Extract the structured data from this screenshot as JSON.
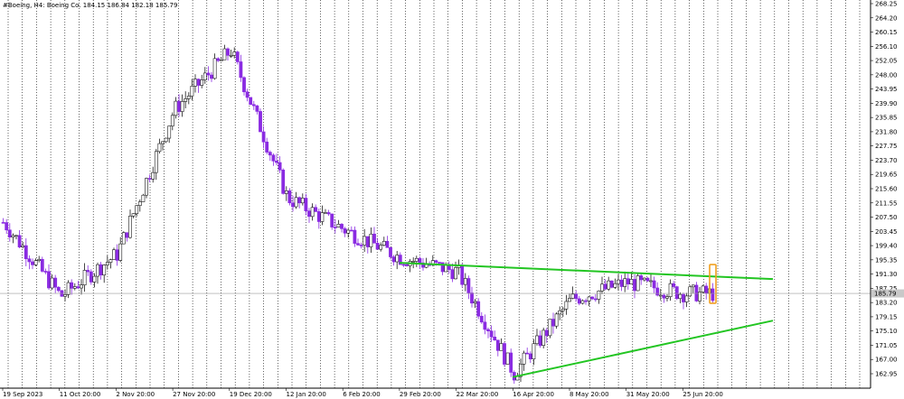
{
  "chart_data": {
    "type": "candlestick",
    "symbol_info": "#Boeing, H4:  Boeing Co.  184.15 186.84 182.18 185.79",
    "current_price": 185.79,
    "current_price_label": "185.79",
    "ylim": [
      160.0,
      268.25
    ],
    "x_ticks": [
      "19 Sep 2023",
      "11 Oct 20:00",
      "2 Nov 20:00",
      "27 Nov 20:00",
      "19 Dec 20:00",
      "12 Jan 20:00",
      "6 Feb 20:00",
      "29 Feb 20:00",
      "22 Mar 20:00",
      "16 Apr 20:00",
      "8 May 20:00",
      "31 May 20:00",
      "25 Jun 20:00"
    ],
    "y_ticks": [
      "268.25",
      "264.20",
      "260.15",
      "256.10",
      "252.05",
      "248.00",
      "243.95",
      "239.90",
      "235.85",
      "231.80",
      "227.75",
      "223.70",
      "219.65",
      "215.60",
      "211.55",
      "207.50",
      "203.45",
      "199.40",
      "195.35",
      "191.30",
      "187.25",
      "183.20",
      "179.15",
      "175.10",
      "171.05",
      "167.00",
      "162.95"
    ],
    "series": [
      {
        "name": "close",
        "x": [
          "19 Sep 2023",
          "11 Oct 20:00",
          "2 Nov 20:00",
          "27 Nov 20:00",
          "19 Dec 20:00",
          "12 Jan 20:00",
          "6 Feb 20:00",
          "29 Feb 20:00",
          "22 Mar 20:00",
          "16 Apr 20:00",
          "8 May 20:00",
          "31 May 20:00",
          "25 Jun 20:00"
        ],
        "values": [
          206.0,
          185.0,
          197.0,
          238.0,
          255.0,
          213.0,
          204.0,
          196.0,
          192.0,
          163.0,
          184.0,
          189.0,
          185.79
        ]
      }
    ],
    "trendlines": [
      {
        "name": "resistance",
        "color": "#22c522",
        "points": [
          [
            "29 Feb 20:00",
            194.5
          ],
          [
            "25 Jun 20:00",
            191.0
          ]
        ]
      },
      {
        "name": "support",
        "color": "#22c522",
        "points": [
          [
            "16 Apr 20:00",
            162.0
          ],
          [
            "25 Jun 20:00",
            172.5
          ]
        ]
      }
    ],
    "highlight": {
      "color": "#f0a020",
      "from": 183.0,
      "to": 194.0
    },
    "colors": {
      "bull": "#1a1a1a",
      "bear": "#8a2be2",
      "grid": "#000000",
      "price_label_bg": "#c8c8c8"
    },
    "grid": "vertical-dotted"
  }
}
